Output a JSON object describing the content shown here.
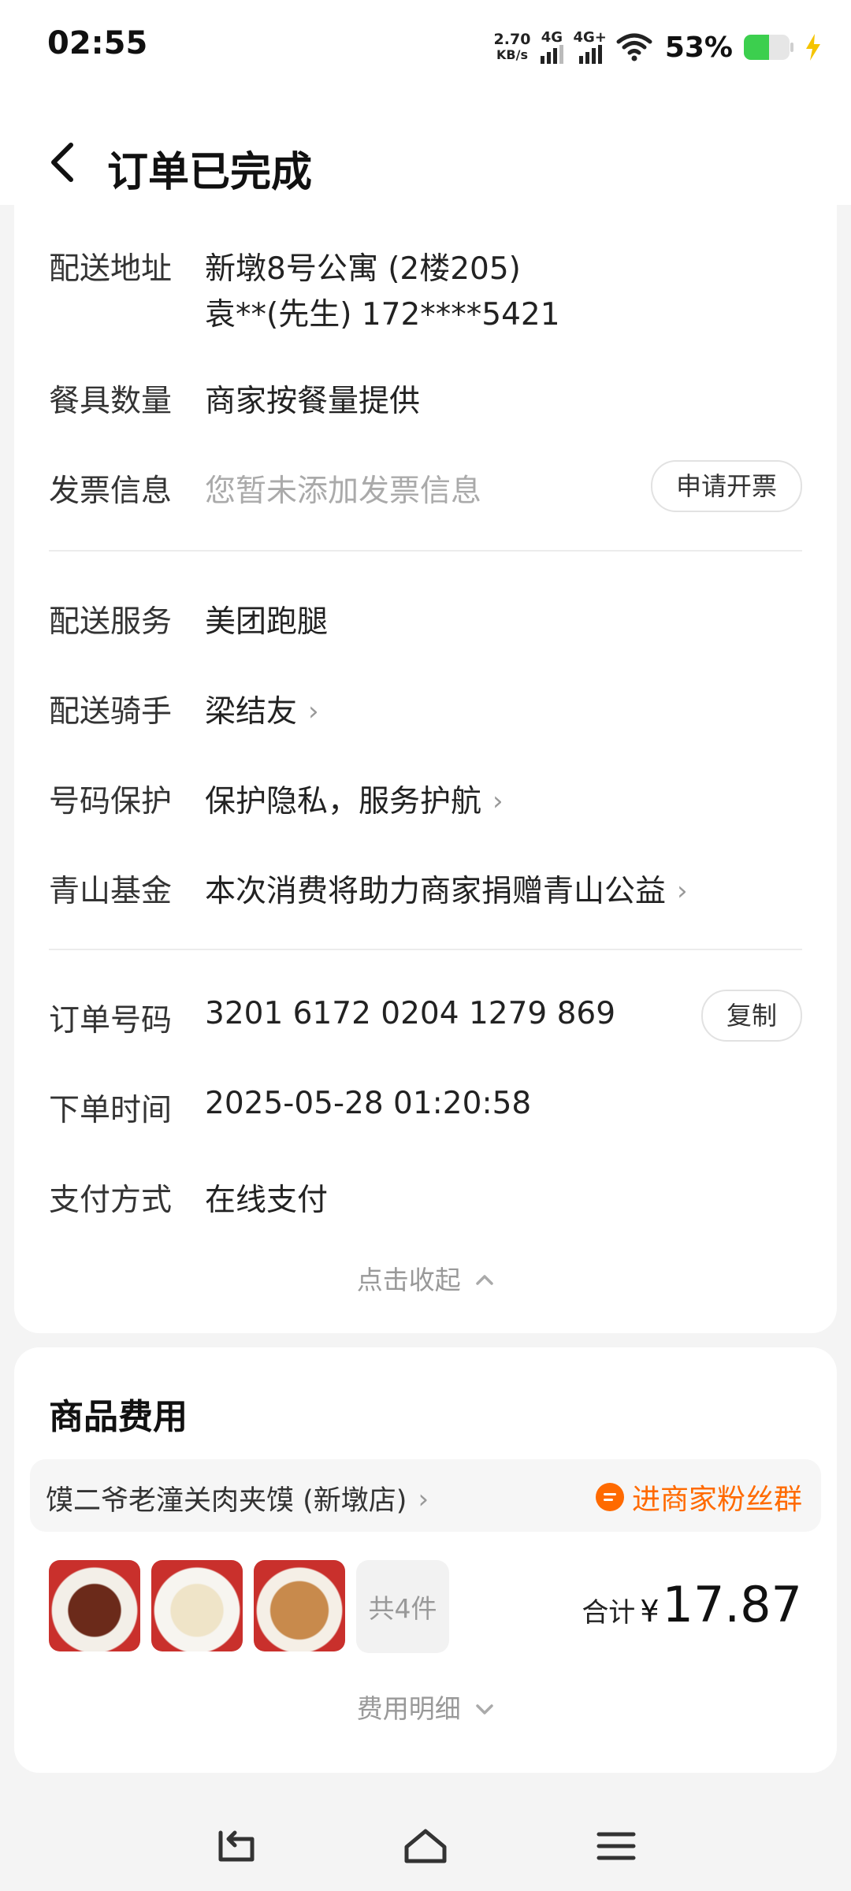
{
  "status_bar": {
    "time": "02:55",
    "net_speed_value": "2.70",
    "net_speed_unit": "KB/s",
    "signal1_label": "4G",
    "signal2_label": "4G+",
    "battery_percent": "53%"
  },
  "header": {
    "title": "订单已完成"
  },
  "info_rows": {
    "address": {
      "label": "配送地址",
      "line1": "新墩8号公寓 (2楼205)",
      "line2": "袁**(先生) 172****5421"
    },
    "tableware": {
      "label": "餐具数量",
      "value": "商家按餐量提供"
    },
    "invoice": {
      "label": "发票信息",
      "value": "您暂未添加发票信息",
      "button": "申请开票"
    },
    "delivery_service": {
      "label": "配送服务",
      "value": "美团跑腿"
    },
    "rider": {
      "label": "配送骑手",
      "value": "梁结友"
    },
    "number_protect": {
      "label": "号码保护",
      "value": "保护隐私，服务护航"
    },
    "qingshan_fund": {
      "label": "青山基金",
      "value": "本次消费将助力商家捐赠青山公益"
    },
    "order_number": {
      "label": "订单号码",
      "value": "3201 6172 0204 1279 869",
      "button": "复制"
    },
    "order_time": {
      "label": "下单时间",
      "value": "2025-05-28 01:20:58"
    },
    "payment": {
      "label": "支付方式",
      "value": "在线支付"
    },
    "collapse": "点击收起"
  },
  "goods": {
    "title": "商品费用",
    "shop_name": "馍二爷老潼关肉夹馍 (新墩店)",
    "fan_group": "进商家粉丝群",
    "item_count": "共4件",
    "total_label": "合计",
    "currency": "¥",
    "total_amount": "17.87",
    "fee_detail": "费用明细"
  },
  "colors": {
    "accent_orange": "#ff6a00",
    "battery_green": "#3ccf4e",
    "page_bg": "#f4f4f4"
  }
}
